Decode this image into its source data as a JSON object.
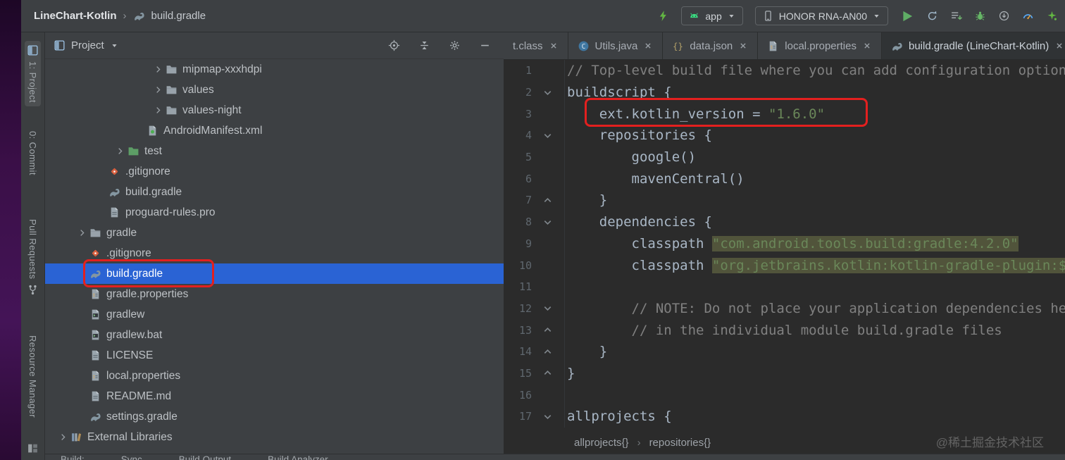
{
  "header": {
    "project": "LineChart-Kotlin",
    "separator": "›",
    "file": "build.gradle",
    "toolbar": {
      "run_config_label": "app",
      "device_label": "HONOR RNA-AN00"
    }
  },
  "stripe": {
    "tabs": [
      {
        "label": "1: Project",
        "icon": "projectPane",
        "active": true,
        "gap": 6
      },
      {
        "label": "0: Commit",
        "gap": 30
      },
      {
        "label": "Pull Requests",
        "icon_after": "fork",
        "gap": 52
      },
      {
        "label": "Resource Manager",
        "gap": 46
      }
    ],
    "bottom_icon": "windows"
  },
  "project_panel": {
    "title": "Project",
    "tree": [
      {
        "label": "mipmap-xxxhdpi",
        "icon": "folder",
        "indent": 5,
        "chevron": true
      },
      {
        "label": "values",
        "icon": "folder",
        "indent": 5,
        "chevron": true
      },
      {
        "label": "values-night",
        "icon": "folder",
        "indent": 5,
        "chevron": true
      },
      {
        "label": "AndroidManifest.xml",
        "icon": "manifest",
        "indent": 4,
        "chevron": false
      },
      {
        "label": "test",
        "icon": "folderTest",
        "indent": 3,
        "chevron": true
      },
      {
        "label": ".gitignore",
        "icon": "git",
        "indent": 2,
        "chevron": false
      },
      {
        "label": "build.gradle",
        "icon": "gradle",
        "indent": 2,
        "chevron": false
      },
      {
        "label": "proguard-rules.pro",
        "icon": "file",
        "indent": 2,
        "chevron": false
      },
      {
        "label": "gradle",
        "icon": "folder",
        "indent": 1,
        "chevron": true
      },
      {
        "label": ".gitignore",
        "icon": "git",
        "indent": 1,
        "chevron": false
      },
      {
        "label": "build.gradle",
        "icon": "gradle",
        "indent": 1,
        "chevron": false,
        "selected": true
      },
      {
        "label": "gradle.properties",
        "icon": "properties",
        "indent": 1,
        "chevron": false
      },
      {
        "label": "gradlew",
        "icon": "script",
        "indent": 1,
        "chevron": false
      },
      {
        "label": "gradlew.bat",
        "icon": "script",
        "indent": 1,
        "chevron": false
      },
      {
        "label": "LICENSE",
        "icon": "file",
        "indent": 1,
        "chevron": false
      },
      {
        "label": "local.properties",
        "icon": "properties",
        "indent": 1,
        "chevron": false
      },
      {
        "label": "README.md",
        "icon": "file",
        "indent": 1,
        "chevron": false
      },
      {
        "label": "settings.gradle",
        "icon": "gradle",
        "indent": 1,
        "chevron": false
      },
      {
        "label": "External Libraries",
        "icon": "library",
        "indent": 0,
        "chevron": true
      }
    ]
  },
  "editor": {
    "tabs": [
      {
        "label": "t.class",
        "icon": null,
        "active": false
      },
      {
        "label": "Utils.java",
        "icon": "classC",
        "active": false
      },
      {
        "label": "data.json",
        "icon": "json",
        "active": false
      },
      {
        "label": "local.properties",
        "icon": "properties",
        "active": false
      },
      {
        "label": "build.gradle (LineChart-Kotlin)",
        "icon": "gradle",
        "active": true
      }
    ],
    "lines": [
      {
        "n": 1,
        "fold": "",
        "segs": [
          {
            "t": "// Top-level build file where you can add configuration options common to all sub-projects/modules.",
            "c": "cmt"
          }
        ]
      },
      {
        "n": 2,
        "fold": "down",
        "segs": [
          {
            "t": "buildscript {",
            "c": "pln"
          }
        ]
      },
      {
        "n": 3,
        "fold": "",
        "segs": [
          {
            "t": "    ext.kotlin_version = ",
            "c": "pln"
          },
          {
            "t": "\"1.6.0\"",
            "c": "str"
          }
        ]
      },
      {
        "n": 4,
        "fold": "down",
        "segs": [
          {
            "t": "    repositories {",
            "c": "pln"
          }
        ]
      },
      {
        "n": 5,
        "fold": "",
        "segs": [
          {
            "t": "        google()",
            "c": "pln"
          }
        ]
      },
      {
        "n": 6,
        "fold": "",
        "segs": [
          {
            "t": "        mavenCentral()",
            "c": "pln"
          }
        ]
      },
      {
        "n": 7,
        "fold": "up",
        "segs": [
          {
            "t": "    }",
            "c": "pln"
          }
        ]
      },
      {
        "n": 8,
        "fold": "down",
        "segs": [
          {
            "t": "    dependencies {",
            "c": "pln"
          }
        ]
      },
      {
        "n": 9,
        "fold": "",
        "segs": [
          {
            "t": "        classpath ",
            "c": "pln"
          },
          {
            "t": "\"com.android.tools.build:gradle:4.2.0\"",
            "c": "str",
            "hl": true
          }
        ]
      },
      {
        "n": 10,
        "fold": "",
        "segs": [
          {
            "t": "        classpath ",
            "c": "pln"
          },
          {
            "t": "\"org.jetbrains.kotlin:kotlin-gradle-plugin:$kotlin_version\"",
            "c": "str",
            "hl": true
          }
        ]
      },
      {
        "n": 11,
        "fold": "",
        "segs": []
      },
      {
        "n": 12,
        "fold": "down",
        "segs": [
          {
            "t": "        // NOTE: Do not place your application dependencies here; they belong",
            "c": "cmt"
          }
        ]
      },
      {
        "n": 13,
        "fold": "up",
        "segs": [
          {
            "t": "        // in the individual module build.gradle files",
            "c": "cmt"
          }
        ]
      },
      {
        "n": 14,
        "fold": "up",
        "segs": [
          {
            "t": "    }",
            "c": "pln"
          }
        ]
      },
      {
        "n": 15,
        "fold": "up",
        "segs": [
          {
            "t": "}",
            "c": "pln"
          }
        ]
      },
      {
        "n": 16,
        "fold": "",
        "segs": []
      },
      {
        "n": 17,
        "fold": "down",
        "segs": [
          {
            "t": "allprojects {",
            "c": "pln"
          }
        ]
      }
    ],
    "breadcrumbs": [
      "allprojects{}",
      "repositories{}"
    ],
    "breadcrumb_separator": "›"
  },
  "bottom_bar": {
    "items": [
      "Build:",
      "Sync",
      "Build Output",
      "Build Analyzer"
    ]
  },
  "watermark": "@稀土掘金技术社区",
  "colors": {
    "selection": "#2a63d4",
    "annotation": "#e3201f",
    "string": "#6a8759",
    "comment": "#808080",
    "plain": "#a9b7c6",
    "string_highlight_bg": "#51543b"
  }
}
